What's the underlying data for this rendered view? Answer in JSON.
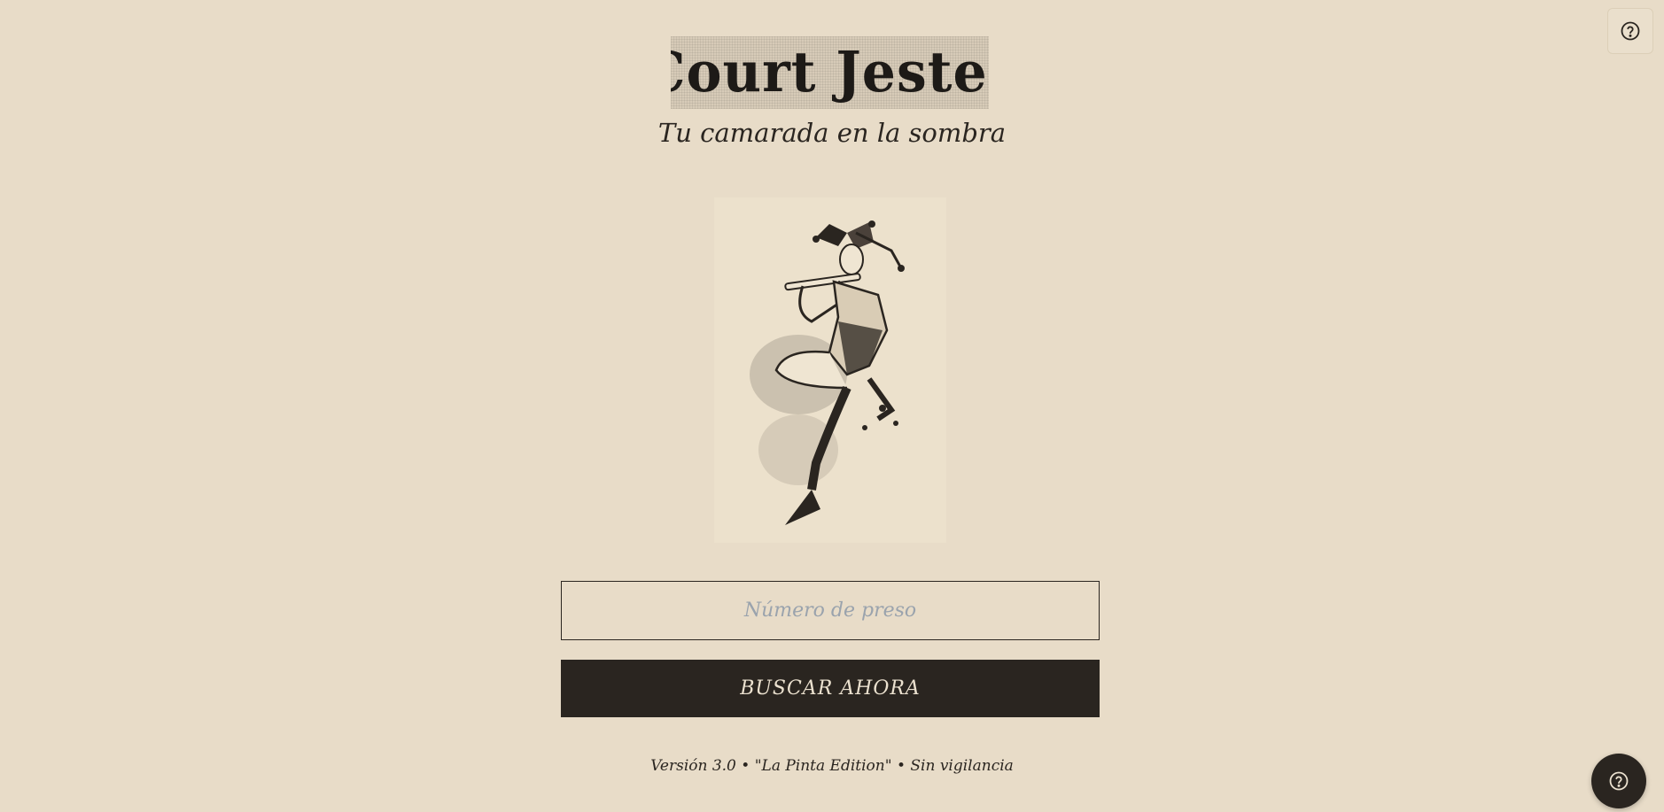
{
  "header": {
    "logo_text": "Court Jester",
    "tagline": "Tu camarada en la sombra"
  },
  "search": {
    "placeholder": "Número de preso",
    "value": "",
    "button_label": "BUSCAR AHORA"
  },
  "footer": {
    "version_text": "Versión 3.0 • \"La Pinta Edition\" • Sin vigilancia"
  },
  "icons": {
    "help_top": "question-circle-icon",
    "help_fab": "question-circle-icon",
    "illustration": "jester-playing-flute"
  },
  "colors": {
    "background": "#e8dcc8",
    "ink": "#2a2520",
    "button_text": "#ebe1cf",
    "placeholder": "#9aa3ad"
  }
}
